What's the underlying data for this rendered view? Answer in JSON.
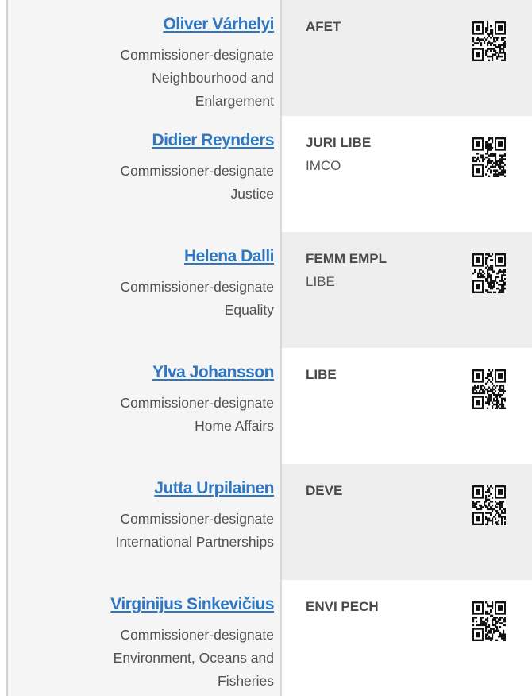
{
  "entries": [
    {
      "name": "Oliver Várhelyi",
      "role_lines": [
        "Commissioner-designate",
        "Neighbourhood and",
        "Enlargement"
      ],
      "committees_bold": "AFET",
      "committees_normal": "",
      "qr_icon": "qr-code-icon"
    },
    {
      "name": "Didier Reynders",
      "role_lines": [
        "Commissioner-designate",
        "Justice",
        ""
      ],
      "committees_bold": "JURI LIBE",
      "committees_normal": "IMCO",
      "qr_icon": "qr-code-icon"
    },
    {
      "name": "Helena Dalli",
      "role_lines": [
        "Commissioner-designate",
        "Equality",
        ""
      ],
      "committees_bold": "FEMM EMPL",
      "committees_normal": "LIBE",
      "qr_icon": "qr-code-icon"
    },
    {
      "name": "Ylva Johansson",
      "role_lines": [
        "Commissioner-designate",
        "Home Affairs",
        ""
      ],
      "committees_bold": "LIBE",
      "committees_normal": "",
      "qr_icon": "qr-code-icon"
    },
    {
      "name": "Jutta Urpilainen",
      "role_lines": [
        "Commissioner-designate",
        "International Partnerships",
        ""
      ],
      "committees_bold": "DEVE",
      "committees_normal": "",
      "qr_icon": "qr-code-icon"
    },
    {
      "name": "Virginijus Sinkevičius",
      "role_lines": [
        "Commissioner-designate",
        "Environment, Oceans and",
        "Fisheries"
      ],
      "committees_bold": "ENVI PECH",
      "committees_normal": "",
      "qr_icon": "qr-code-icon"
    }
  ],
  "colors": {
    "link": "#2f77c0",
    "text": "#505050",
    "shade": "#eeeeee",
    "left_bg": "#f5f5f5"
  }
}
